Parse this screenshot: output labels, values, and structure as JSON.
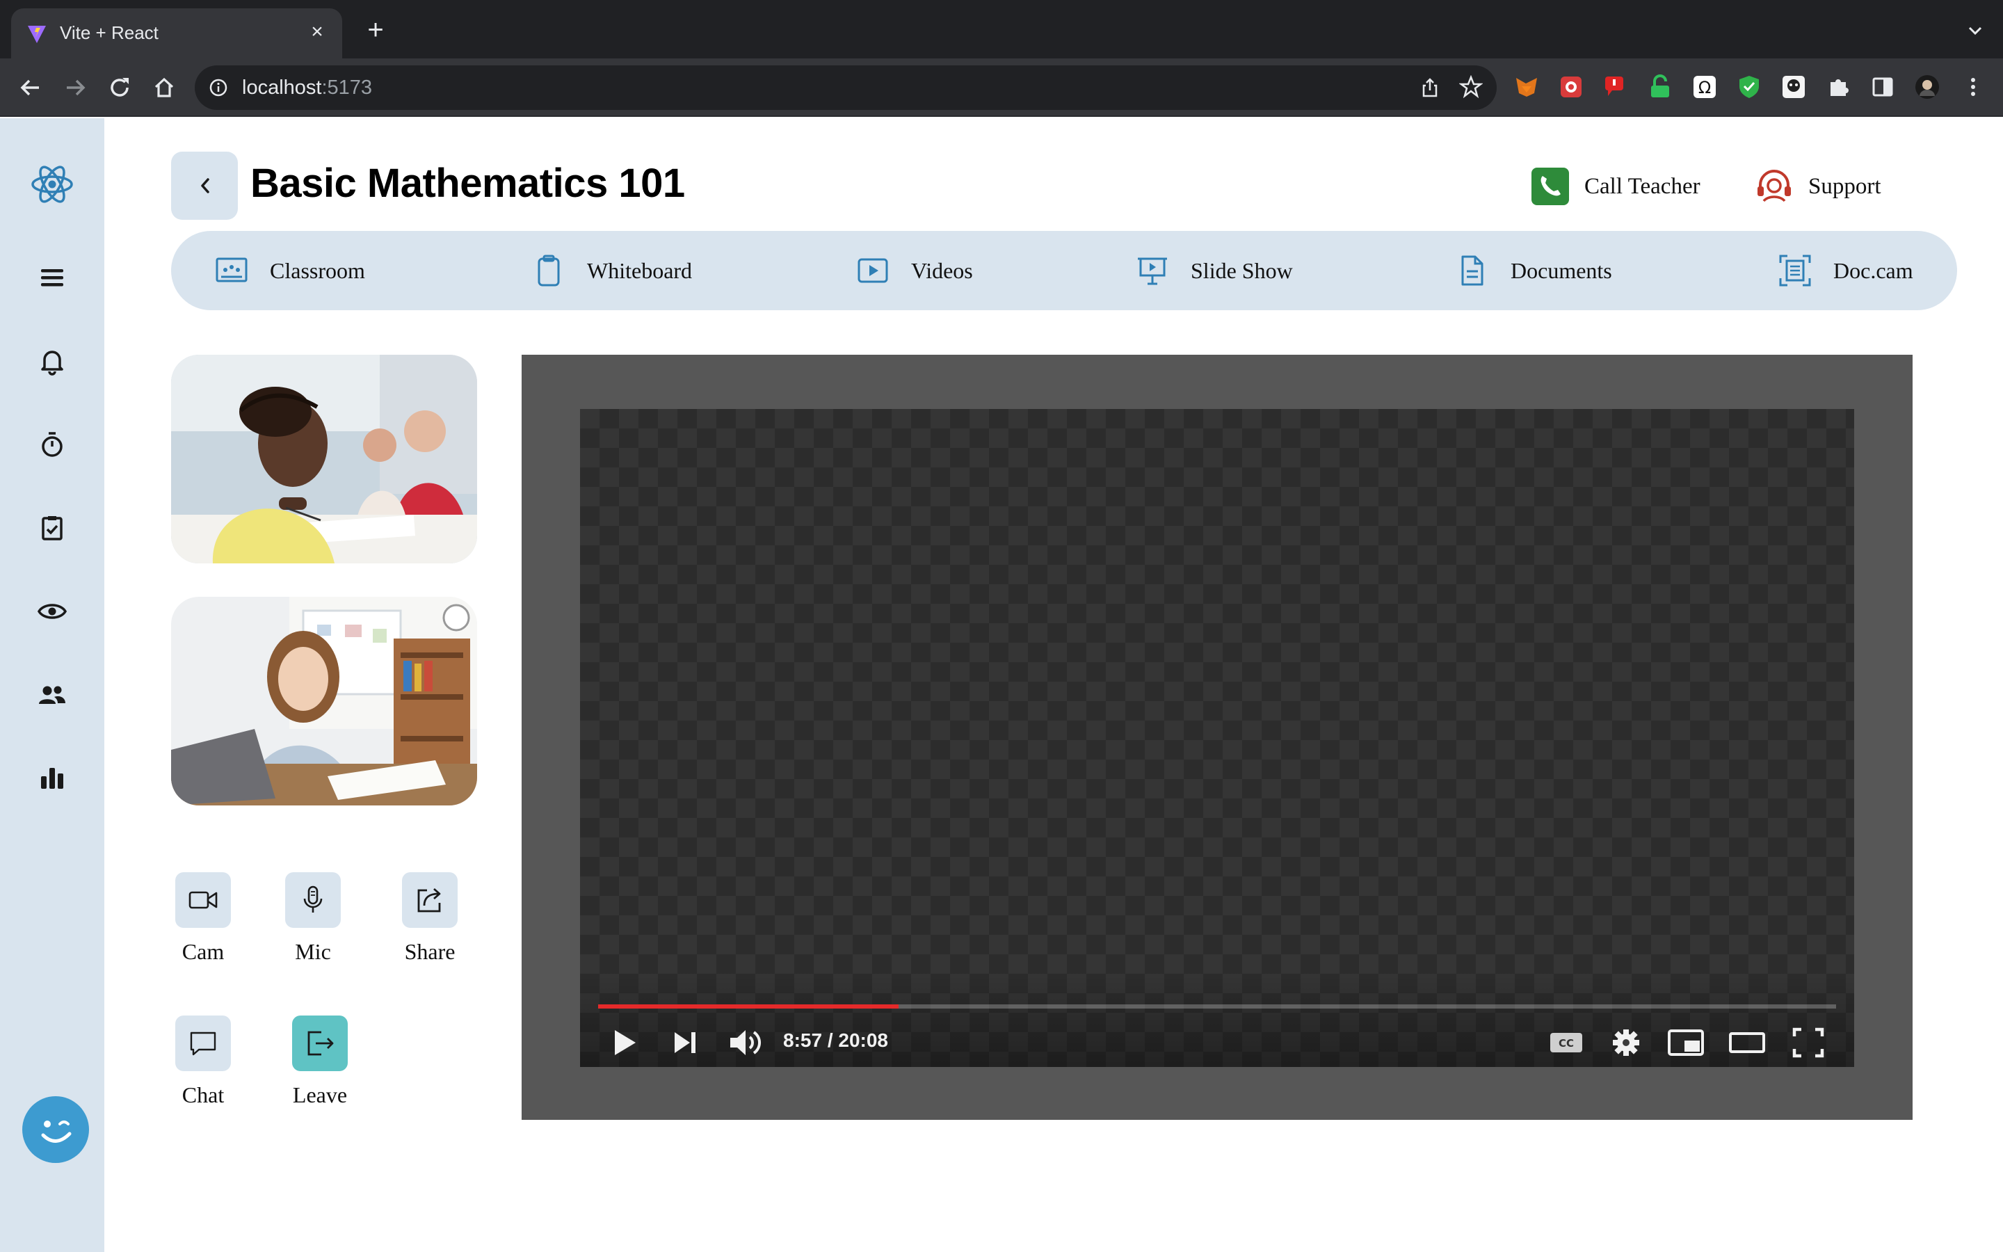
{
  "browser": {
    "tab_title": "Vite + React",
    "url_host": "localhost",
    "url_port": ":5173"
  },
  "sidebar": {
    "items": [
      {
        "icon": "react-logo-icon"
      },
      {
        "icon": "menu-icon"
      },
      {
        "icon": "bell-icon"
      },
      {
        "icon": "timer-icon"
      },
      {
        "icon": "clipboard-check-icon"
      },
      {
        "icon": "eye-icon"
      },
      {
        "icon": "users-icon"
      },
      {
        "icon": "bar-chart-icon"
      }
    ]
  },
  "header": {
    "title": "Basic Mathematics 101",
    "call_teacher": "Call Teacher",
    "support": "Support"
  },
  "nav": {
    "classroom": "Classroom",
    "whiteboard": "Whiteboard",
    "videos": "Videos",
    "slideshow": "Slide Show",
    "documents": "Documents",
    "doccam": "Doc.cam"
  },
  "controls": {
    "cam": "Cam",
    "mic": "Mic",
    "share": "Share",
    "chat": "Chat",
    "leave": "Leave"
  },
  "video": {
    "time": "8:57 / 20:08",
    "progress_fraction": 0.2425
  },
  "colors": {
    "sidebar_bg": "#d9e4ee",
    "accent_teal": "#5fc3c4",
    "call_green": "#2e8b3a",
    "support_red": "#c0392b",
    "progress_red": "#e52a2a"
  }
}
